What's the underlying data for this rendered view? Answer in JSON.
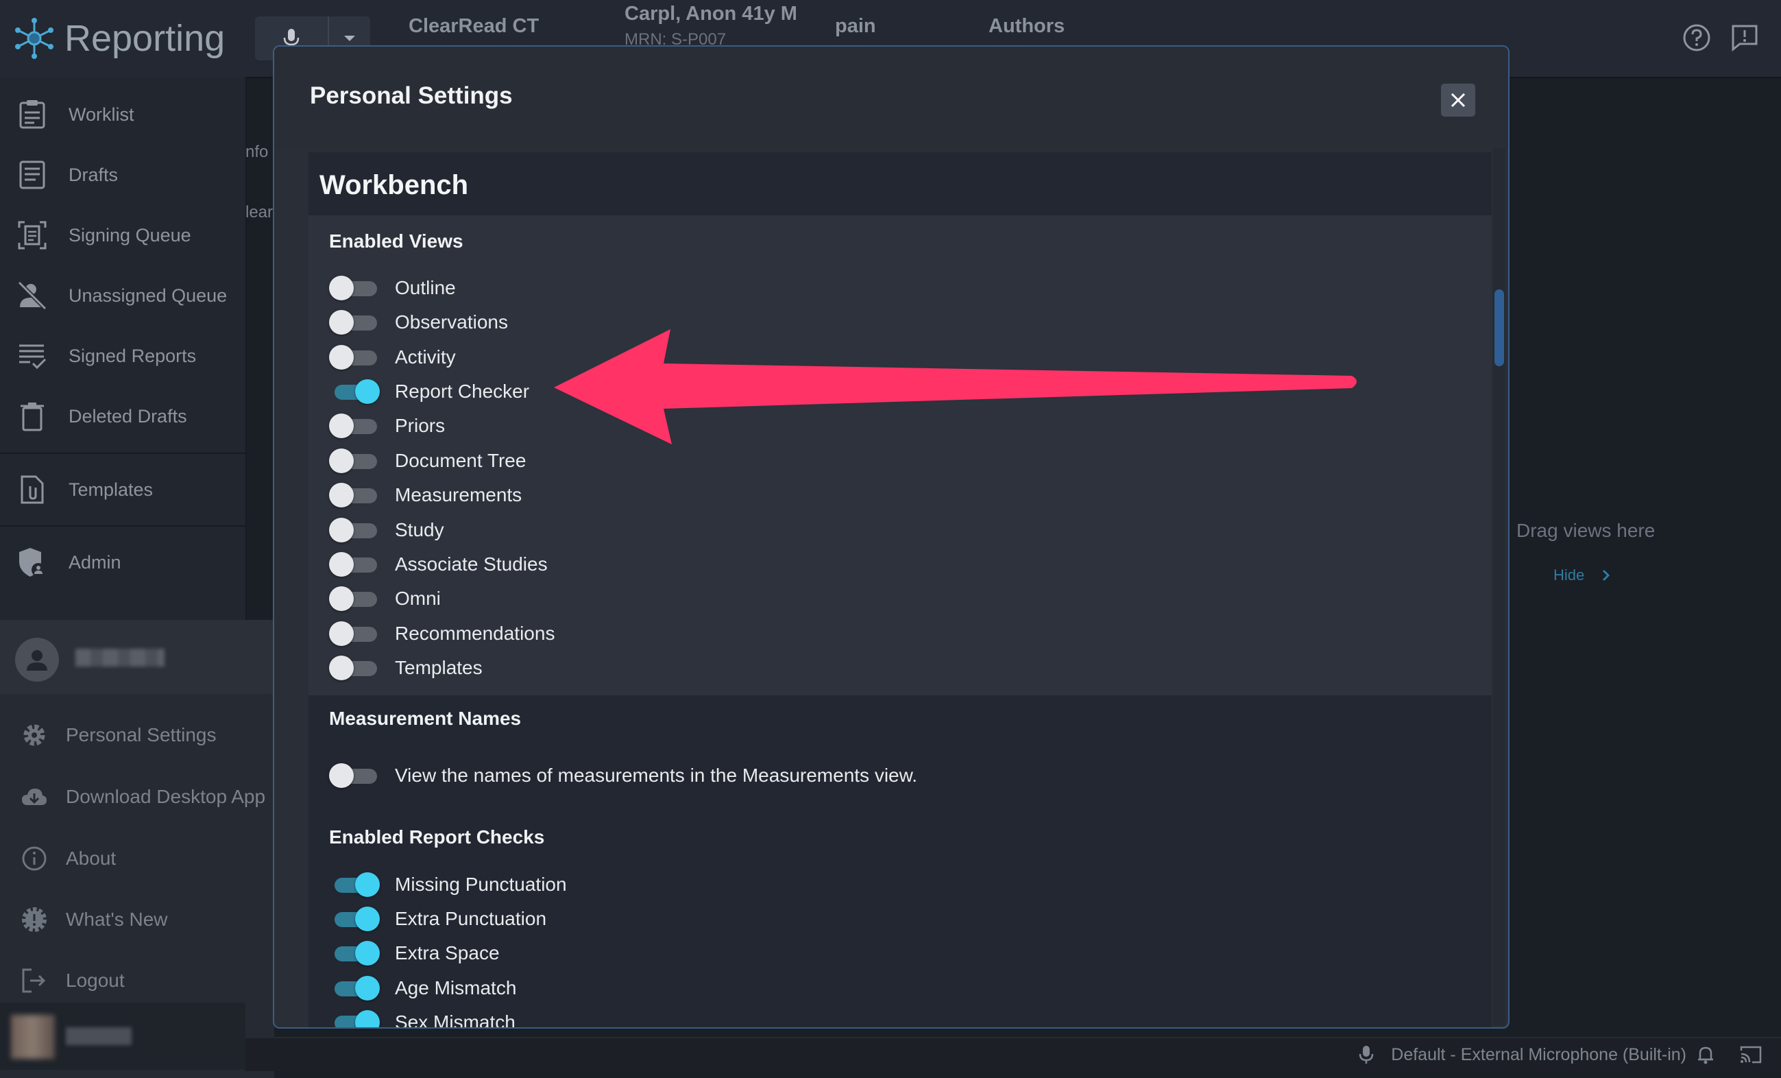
{
  "topbar": {
    "app_title": "Reporting",
    "study": "ClearRead CT",
    "patient": "Carpl, Anon 41y M",
    "mrn": "MRN: S-P007",
    "indication": "pain",
    "authors": "Authors"
  },
  "sidebar": {
    "items": [
      {
        "label": "Worklist",
        "icon": "worklist-icon"
      },
      {
        "label": "Drafts",
        "icon": "drafts-icon"
      },
      {
        "label": "Signing Queue",
        "icon": "signing-queue-icon"
      },
      {
        "label": "Unassigned Queue",
        "icon": "unassigned-user-icon"
      },
      {
        "label": "Signed Reports",
        "icon": "signed-reports-icon"
      },
      {
        "label": "Deleted Drafts",
        "icon": "trash-icon"
      },
      {
        "label": "Templates",
        "icon": "templates-icon"
      },
      {
        "label": "Admin",
        "icon": "admin-shield-icon"
      }
    ],
    "lower_items": [
      {
        "label": "Personal Settings",
        "icon": "gear-icon"
      },
      {
        "label": "Download Desktop App",
        "icon": "cloud-download-icon"
      },
      {
        "label": "About",
        "icon": "info-icon"
      },
      {
        "label": "What's New",
        "icon": "badge-alert-icon"
      },
      {
        "label": "Logout",
        "icon": "logout-icon"
      }
    ]
  },
  "background": {
    "peek_1": "nfo",
    "peek_2": "lear",
    "drag_views": "Drag views here",
    "hide": "Hide"
  },
  "statusbar": {
    "microphone": "Default - External Microphone (Built-in)"
  },
  "modal": {
    "title": "Personal Settings",
    "section": "Workbench",
    "enabled_views_title": "Enabled Views",
    "enabled_views": [
      {
        "label": "Outline",
        "on": false
      },
      {
        "label": "Observations",
        "on": false
      },
      {
        "label": "Activity",
        "on": false
      },
      {
        "label": "Report Checker",
        "on": true
      },
      {
        "label": "Priors",
        "on": false
      },
      {
        "label": "Document Tree",
        "on": false
      },
      {
        "label": "Measurements",
        "on": false
      },
      {
        "label": "Study",
        "on": false
      },
      {
        "label": "Associate Studies",
        "on": false
      },
      {
        "label": "Omni",
        "on": false
      },
      {
        "label": "Recommendations",
        "on": false
      },
      {
        "label": "Templates",
        "on": false
      }
    ],
    "measurement_names_title": "Measurement Names",
    "measurement_names_option": {
      "label": "View the names of measurements in the Measurements view.",
      "on": false
    },
    "report_checks_title": "Enabled Report Checks",
    "report_checks": [
      {
        "label": "Missing Punctuation",
        "on": true
      },
      {
        "label": "Extra Punctuation",
        "on": true
      },
      {
        "label": "Extra Space",
        "on": true
      },
      {
        "label": "Age Mismatch",
        "on": true
      },
      {
        "label": "Sex Mismatch",
        "on": true
      }
    ]
  },
  "annotation": {
    "arrow_color": "#ff3366"
  },
  "colors": {
    "accent": "#3fd0f2",
    "modal_border": "#3a5d84"
  }
}
